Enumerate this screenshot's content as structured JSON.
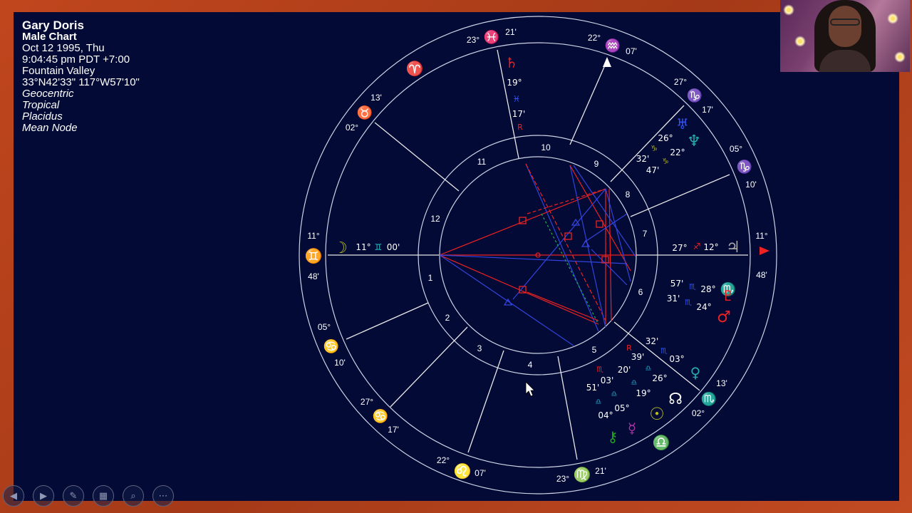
{
  "chart_info": {
    "name": "Gary Doris",
    "chart_type": "Male Chart",
    "date": "Oct 12 1995, Thu",
    "time": "9:04:45 pm  PDT +7:00",
    "place": "Fountain Valley",
    "coords": "33°N42'33\" 117°W57'10\"",
    "settings": [
      "Geocentric",
      "Tropical",
      "Placidus",
      "Mean Node"
    ]
  },
  "houses": [
    "1",
    "2",
    "3",
    "4",
    "5",
    "6",
    "7",
    "8",
    "9",
    "10",
    "11",
    "12"
  ],
  "cusps": [
    {
      "sign": "♊",
      "color": "#22cccc",
      "deg": "11°",
      "min": "48'"
    },
    {
      "sign": "♋",
      "color": "#3355ff",
      "deg": "05°",
      "min": "10'"
    },
    {
      "sign": "♋",
      "color": "#3355ff",
      "deg": "27°",
      "min": "17'"
    },
    {
      "sign": "♌",
      "color": "#ee2222",
      "deg": "22°",
      "min": "07'"
    },
    {
      "sign": "♍",
      "color": "#aaaa22",
      "deg": "23°",
      "min": "21'"
    },
    {
      "sign": "♏",
      "color": "#3355ff",
      "deg": "02°",
      "min": "13'"
    },
    {
      "sign": "♐",
      "color": "#ee2222",
      "deg": "11°",
      "min": "48'"
    },
    {
      "sign": "♑",
      "color": "#aaaa22",
      "deg": "05°",
      "min": "10'"
    },
    {
      "sign": "♑",
      "color": "#aaaa22",
      "deg": "27°",
      "min": "17'"
    },
    {
      "sign": "♒",
      "color": "#22cccc",
      "deg": "22°",
      "min": "07'"
    },
    {
      "sign": "♓",
      "color": "#3355ff",
      "deg": "23°",
      "min": "21'"
    },
    {
      "sign": "♉",
      "color": "#aaaa22",
      "deg": "13'",
      "min": "02°"
    }
  ],
  "aries_glyph": {
    "sign": "♈",
    "color": "#ee2222"
  },
  "planets": [
    {
      "name": "moon",
      "glyph": "☽",
      "color": "#bbbb22",
      "deg": "11°",
      "sign": "♊",
      "min": "00'"
    },
    {
      "name": "jupiter",
      "glyph": "♃",
      "color": "#aaaaaa",
      "deg": "27°",
      "sign": "♐",
      "min": "12°"
    },
    {
      "name": "saturn",
      "glyph": "♄",
      "color": "#ee2222",
      "deg": "19°",
      "sign": "♓",
      "min": "17'",
      "retro": "R"
    },
    {
      "name": "uranus",
      "glyph": "♅",
      "color": "#3355ff",
      "deg": "26°",
      "sign": "♑",
      "min": "32'"
    },
    {
      "name": "neptune",
      "glyph": "♆",
      "color": "#22aaaa",
      "deg": "22°",
      "sign": "♑",
      "min": "47'"
    },
    {
      "name": "pluto",
      "glyph": "♇",
      "color": "#ee2222",
      "deg": "28°",
      "sign": "♏",
      "min": "57'"
    },
    {
      "name": "mars",
      "glyph": "♂",
      "color": "#ee2222",
      "deg": "24°",
      "sign": "♏",
      "min": "31'"
    },
    {
      "name": "venus",
      "glyph": "♀",
      "color": "#22aaaa",
      "deg": "03°",
      "sign": "♏",
      "min": "32'"
    },
    {
      "name": "node",
      "glyph": "☊",
      "color": "#ffffff",
      "deg": "26°",
      "sign": "♎",
      "min": "39'"
    },
    {
      "name": "sun",
      "glyph": "☉",
      "color": "#bbbb22",
      "deg": "19°",
      "sign": "♎",
      "min": "03'"
    },
    {
      "name": "mercury",
      "glyph": "☿",
      "color": "#aa33aa",
      "deg": "05°",
      "sign": "♎",
      "min": "51'"
    },
    {
      "name": "chiron",
      "glyph": "⚷",
      "color": "#22aa22",
      "deg": "04°",
      "sign": "♎",
      "min": "20'"
    }
  ],
  "extra_labels": {
    "libra_glyph": "♎",
    "scorpio_glyph": "♏",
    "retro": "R"
  },
  "colors": {
    "background": "#020a35",
    "frame": "#b8431f",
    "red": "#ee2222",
    "blue": "#3344dd",
    "white": "#ffffff"
  },
  "controls": [
    {
      "name": "prev-slide-button",
      "glyph": "◀"
    },
    {
      "name": "next-slide-button",
      "glyph": "▶"
    },
    {
      "name": "pen-tool-button",
      "glyph": "✎"
    },
    {
      "name": "slides-grid-button",
      "glyph": "▦"
    },
    {
      "name": "zoom-button",
      "glyph": "⌕"
    },
    {
      "name": "more-options-button",
      "glyph": "⋯"
    }
  ]
}
